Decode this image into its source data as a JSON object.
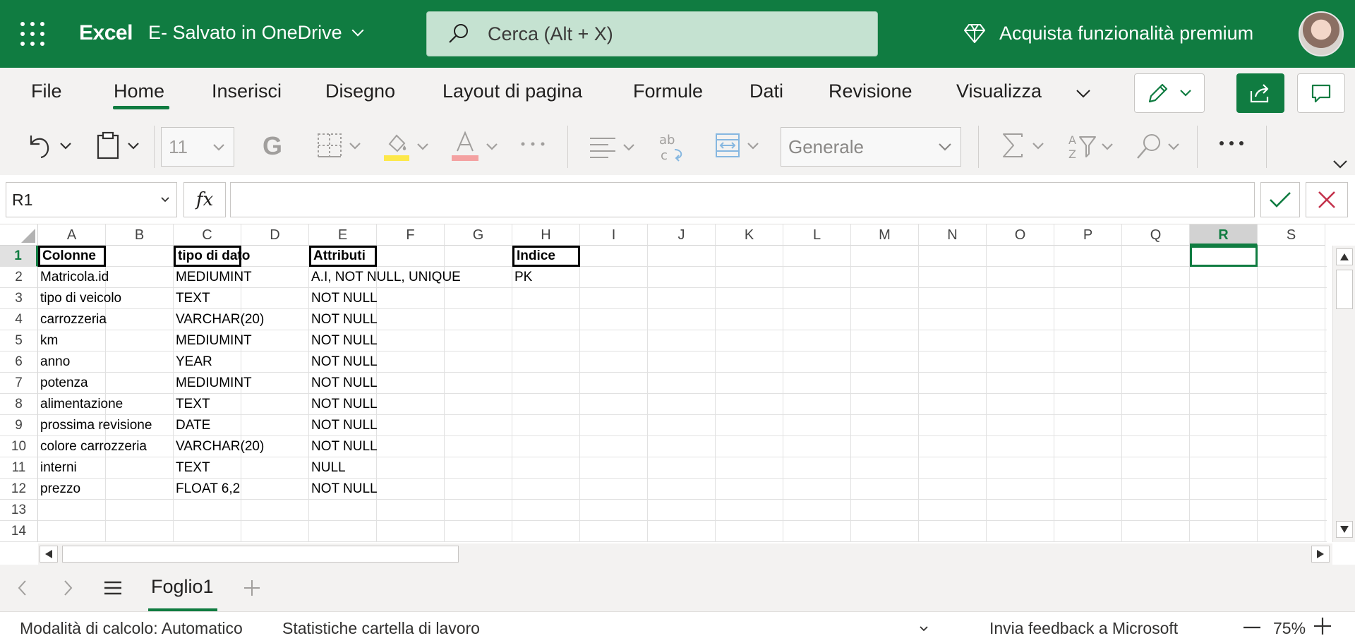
{
  "header": {
    "app_name": "Excel",
    "doc_title": "E-  Salvato in OneDrive",
    "search_placeholder": "Cerca (Alt + X)",
    "premium_label": "Acquista funzionalità premium"
  },
  "ribbon": {
    "tabs": [
      "File",
      "Home",
      "Inserisci",
      "Disegno",
      "Layout di pagina",
      "Formule",
      "Dati",
      "Revisione",
      "Visualizza"
    ],
    "active_tab": "Home",
    "font_size": "11",
    "bold_label": "G",
    "number_format": "Generale"
  },
  "formula_bar": {
    "name_box": "R1",
    "fx_label": "fx",
    "content": ""
  },
  "grid": {
    "columns": [
      "A",
      "B",
      "C",
      "D",
      "E",
      "F",
      "G",
      "H",
      "I",
      "J",
      "K",
      "L",
      "M",
      "N",
      "O",
      "P",
      "Q",
      "R",
      "S"
    ],
    "selected_column": "R",
    "rows": [
      "1",
      "2",
      "3",
      "4",
      "5",
      "6",
      "7",
      "8",
      "9",
      "10",
      "11",
      "12",
      "13",
      "14"
    ],
    "selected_row": "1",
    "data": {
      "A": [
        "Colonne",
        "Matricola.id",
        "tipo di veicolo",
        "carrozzeria",
        "km",
        "anno",
        "potenza",
        "alimentazione",
        "prossima revisione",
        "colore carrozzeria",
        "interni",
        "prezzo"
      ],
      "C": [
        "tipo di dato",
        "MEDIUMINT",
        "TEXT",
        "VARCHAR(20)",
        "MEDIUMINT",
        "YEAR",
        "MEDIUMINT",
        "TEXT",
        "DATE",
        "VARCHAR(20)",
        "TEXT",
        "FLOAT 6,2"
      ],
      "E": [
        "Attributi",
        "A.I, NOT NULL, UNIQUE",
        "NOT NULL",
        "NOT NULL",
        "NOT NULL",
        "NOT NULL",
        "NOT NULL",
        "NOT NULL",
        "NOT NULL",
        "NOT NULL",
        "NULL",
        "NOT NULL"
      ],
      "H": [
        "Indice",
        "PK"
      ]
    }
  },
  "sheets": {
    "active": "Foglio1"
  },
  "status": {
    "calc_mode": "Modalità di calcolo: Automatico",
    "workbook_stats": "Statistiche cartella di lavoro",
    "feedback": "Invia feedback a Microsoft",
    "zoom": "75%"
  },
  "colors": {
    "brand": "#107c41",
    "ribbon_bg": "#f3f2f1"
  }
}
